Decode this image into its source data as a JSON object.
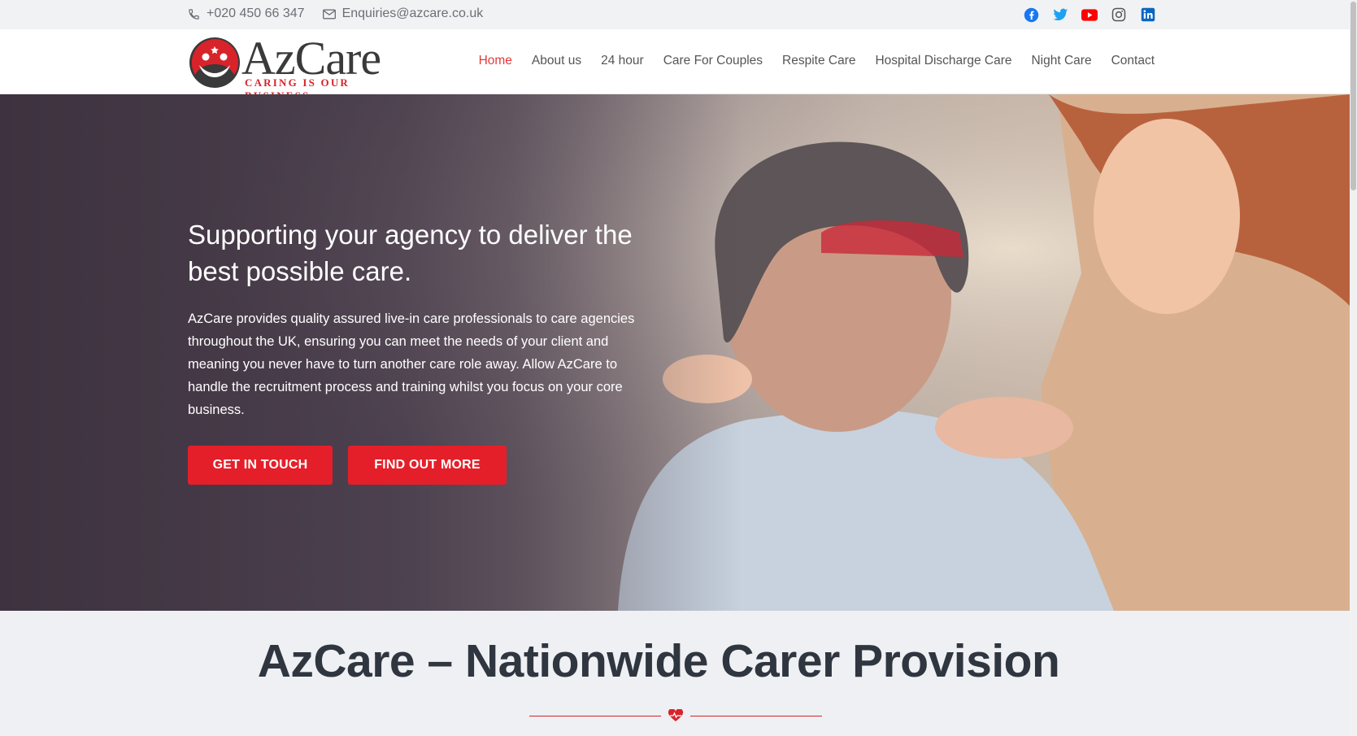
{
  "topbar": {
    "phone_icon": "phone-icon",
    "phone": "+020 450 66 347",
    "email_icon": "envelope-icon",
    "email": "Enquiries@azcare.co.uk",
    "social": [
      {
        "name": "facebook-icon",
        "color": "#1877f2"
      },
      {
        "name": "twitter-icon",
        "color": "#1da1f2"
      },
      {
        "name": "youtube-icon",
        "color": "#ff0000"
      },
      {
        "name": "instagram-icon",
        "color": "#555555"
      },
      {
        "name": "linkedin-icon",
        "color": "#0a66c2"
      }
    ]
  },
  "logo": {
    "wordmark": "AzCare",
    "tagline": "CARING IS OUR BUSINESS",
    "brand_color": "#d8232a"
  },
  "nav": {
    "items": [
      "Home",
      "About us",
      "24 hour",
      "Care For Couples",
      "Respite Care",
      "Hospital Discharge Care",
      "Night Care",
      "Contact"
    ],
    "active_color": "#e5383b"
  },
  "hero": {
    "heading": "Supporting your agency to deliver the best possible care.",
    "body": "AzCare provides quality assured live-in care professionals to care agencies throughout the UK, ensuring you can meet the needs of your client and meaning you never have to turn another care role away. Allow AzCare to handle the recruitment process and training whilst you focus on your core business.",
    "button_primary": "GET IN TOUCH",
    "button_secondary": "FIND OUT MORE",
    "button_color": "#e51f29"
  },
  "section": {
    "title": "AzCare – Nationwide Carer Provision",
    "divider_icon": "heartbeat-icon"
  }
}
